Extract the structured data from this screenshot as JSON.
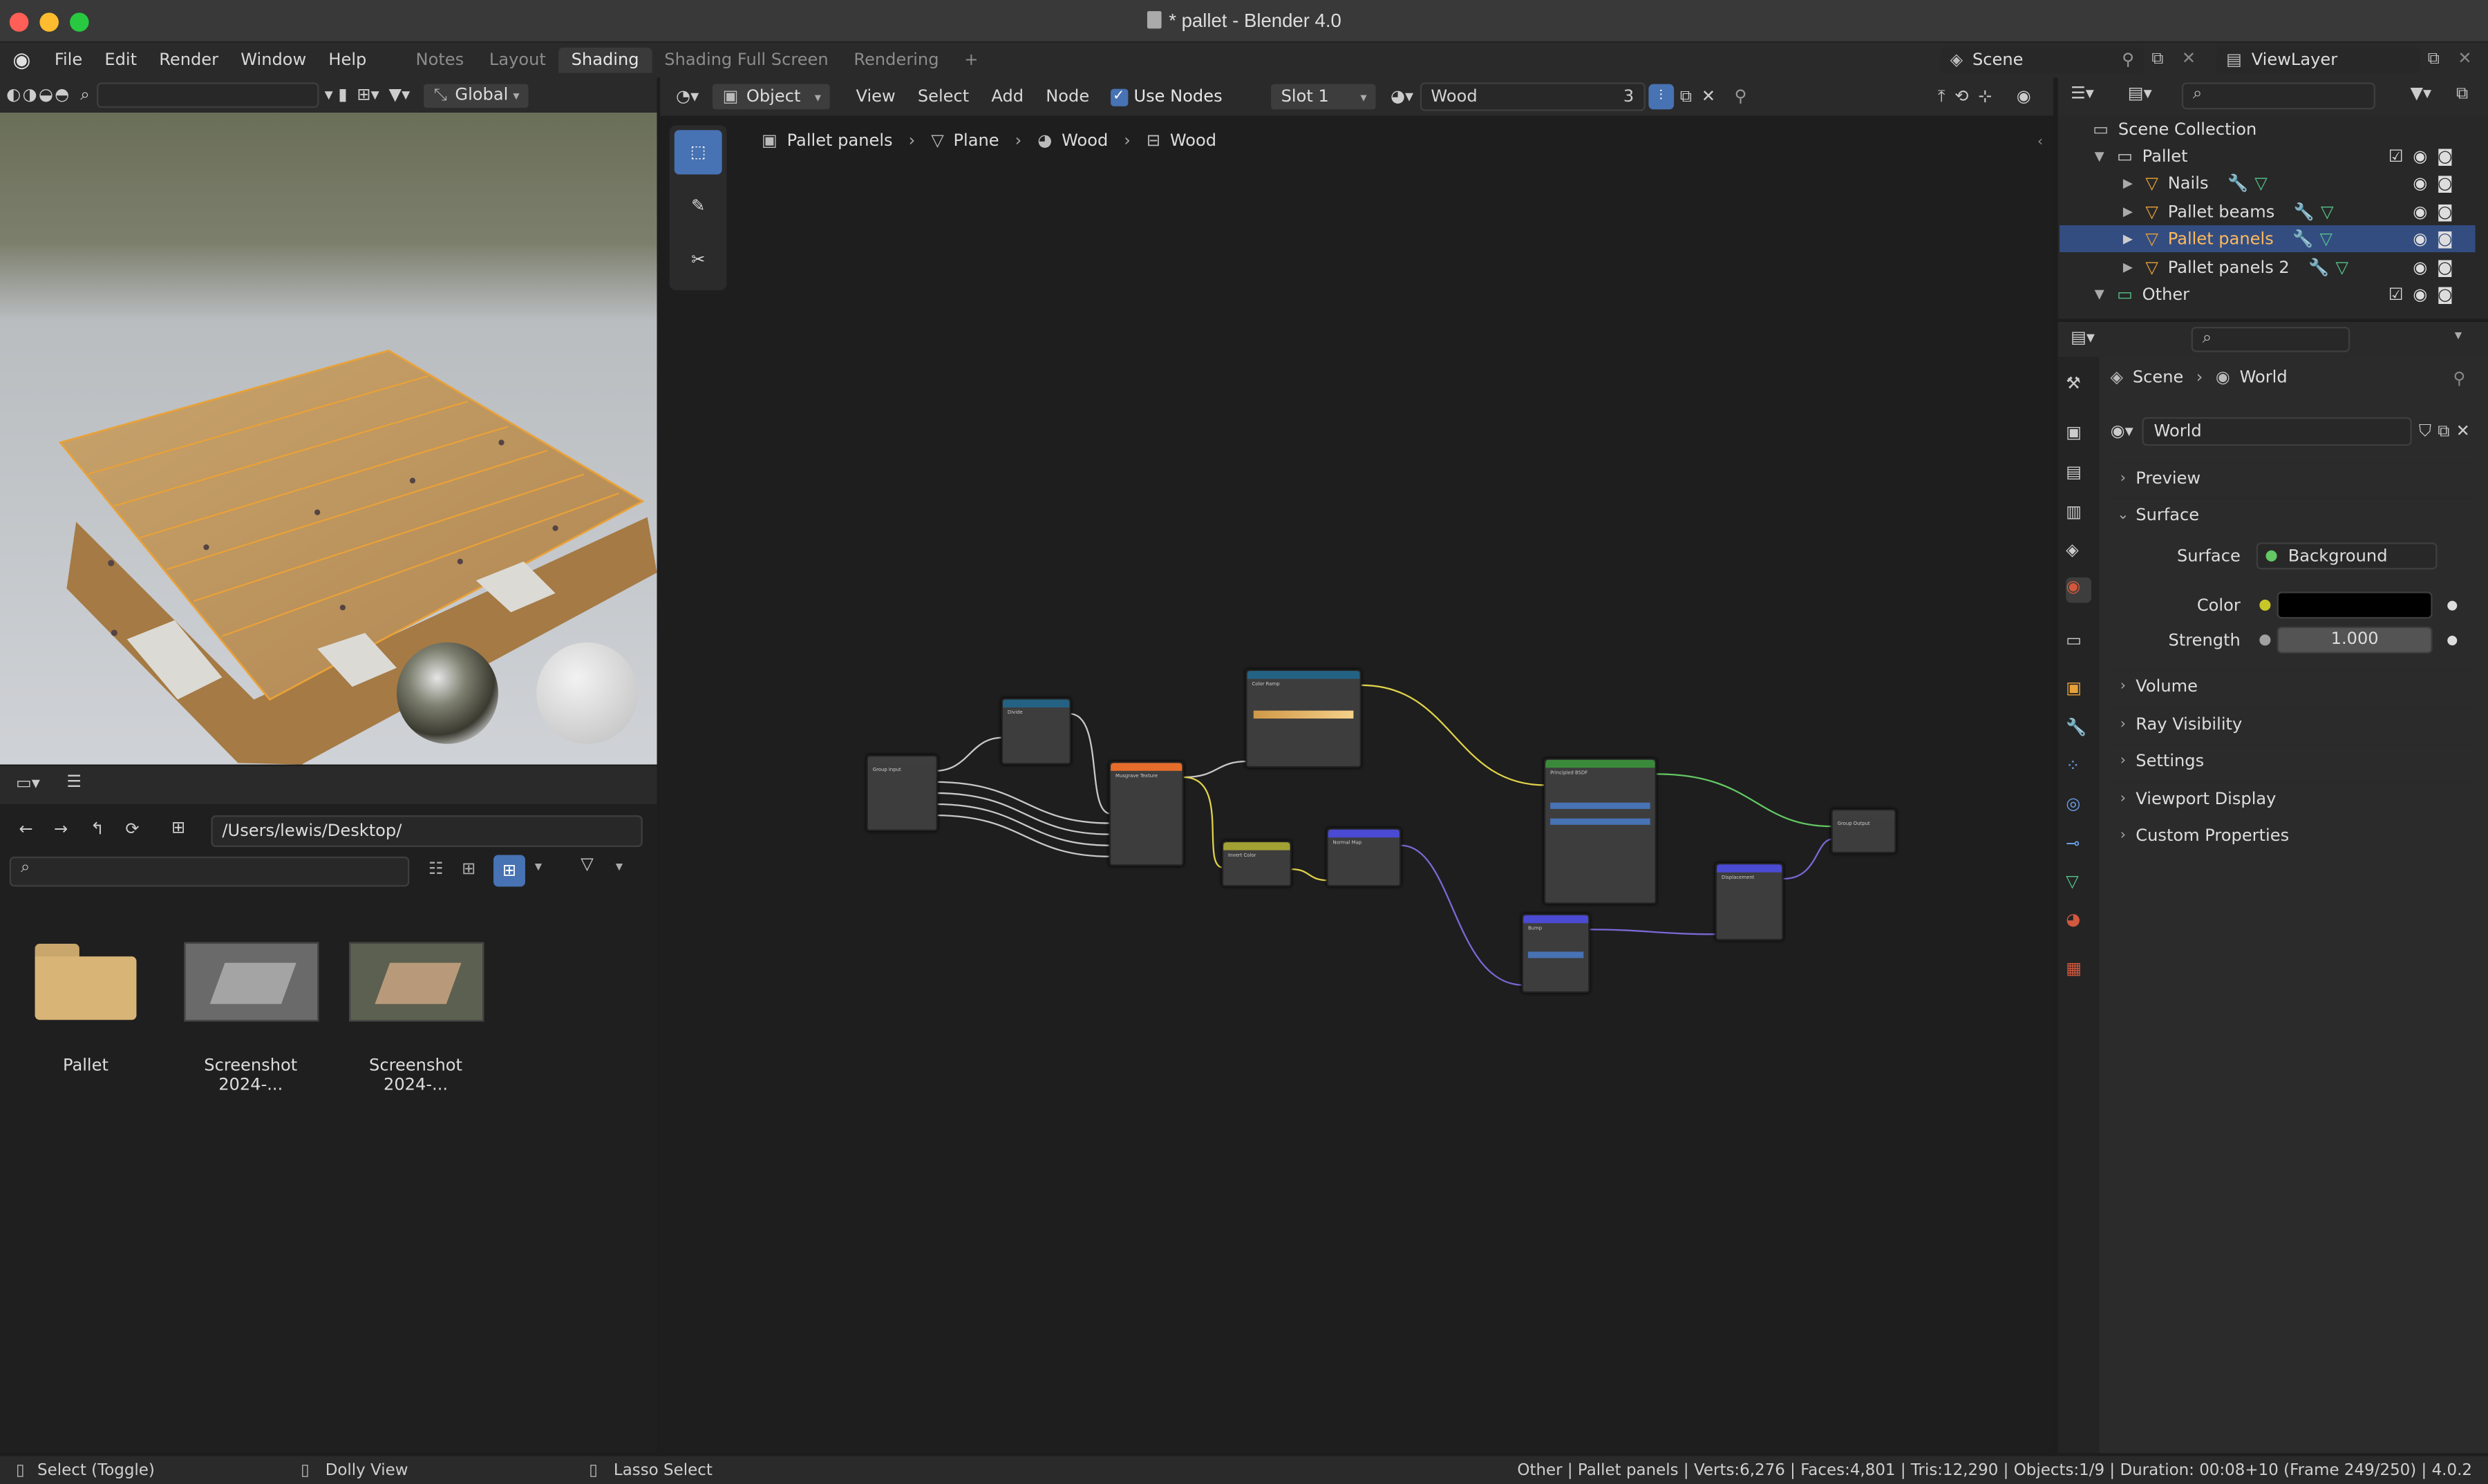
{
  "window": {
    "title": "* pallet - Blender 4.0"
  },
  "menu": [
    "File",
    "Edit",
    "Render",
    "Window",
    "Help"
  ],
  "workspaces": [
    "Notes",
    "Layout",
    "Shading",
    "Shading Full Screen",
    "Rendering"
  ],
  "active_workspace": "Shading",
  "scene": {
    "name": "Scene",
    "view_layer": "ViewLayer"
  },
  "viewport": {
    "orientation": "Global"
  },
  "file_browser": {
    "path": "/Users/lewis/Desktop/",
    "items": [
      {
        "name": "Pallet",
        "type": "folder"
      },
      {
        "name": "Screenshot 2024-...",
        "type": "image"
      },
      {
        "name": "Screenshot 2024-...",
        "type": "image"
      }
    ]
  },
  "node_editor": {
    "mode": "Object",
    "menus": [
      "View",
      "Select",
      "Add",
      "Node"
    ],
    "use_nodes_label": "Use Nodes",
    "use_nodes": true,
    "slot": "Slot 1",
    "material": "Wood",
    "users": "3",
    "breadcrumb": [
      "Pallet panels",
      "Plane",
      "Wood",
      "Wood"
    ],
    "nodes": [
      "Group Input",
      "Divide",
      "Musgrave Texture",
      "Color Ramp",
      "Invert Color",
      "Normal Map",
      "Principled BSDF",
      "Bump",
      "Displacement",
      "Group Output"
    ]
  },
  "outliner": {
    "root": "Scene Collection",
    "items": [
      {
        "label": "Pallet",
        "type": "collection",
        "expanded": true
      },
      {
        "label": "Nails",
        "type": "mesh"
      },
      {
        "label": "Pallet beams",
        "type": "mesh"
      },
      {
        "label": "Pallet panels",
        "type": "mesh",
        "selected": true
      },
      {
        "label": "Pallet panels 2",
        "type": "mesh"
      },
      {
        "label": "Other",
        "type": "collection",
        "expanded": true
      }
    ]
  },
  "properties": {
    "breadcrumb": [
      "Scene",
      "World"
    ],
    "world_name": "World",
    "panels": {
      "preview": "Preview",
      "surface": "Surface",
      "volume": "Volume",
      "ray_visibility": "Ray Visibility",
      "settings": "Settings",
      "viewport_display": "Viewport Display",
      "custom_properties": "Custom Properties"
    },
    "surface_label": "Surface",
    "surface_value": "Background",
    "color_label": "Color",
    "color_value": "#000000",
    "strength_label": "Strength",
    "strength_value": "1.000"
  },
  "statusbar": {
    "hints": [
      "Select (Toggle)",
      "Dolly View",
      "Lasso Select"
    ],
    "info": "Other | Pallet panels | Verts:6,276 | Faces:4,801 | Tris:12,290 | Objects:1/9 | Duration: 00:08+10 (Frame 249/250) | 4.0.2"
  },
  "colors": {
    "accent": "#4772b3",
    "selected_row": "#334d80",
    "object_orange": "#e8a139",
    "world_red": "#d2583e"
  }
}
